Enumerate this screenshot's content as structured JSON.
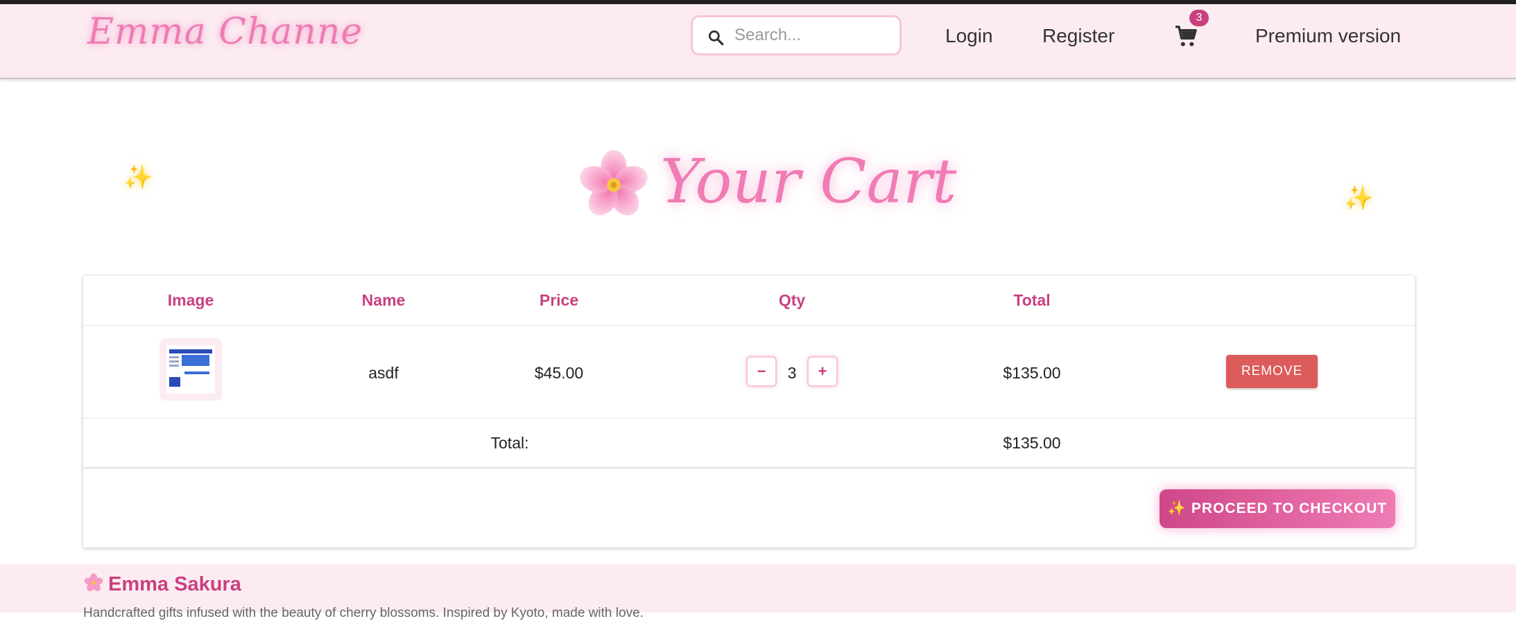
{
  "header": {
    "logo": "Emma Channe",
    "search": {
      "placeholder": "Search...",
      "value": ""
    },
    "nav": {
      "login": "Login",
      "register": "Register",
      "premium": "Premium version"
    },
    "cart_count": "3"
  },
  "main": {
    "title": "Your Cart",
    "sparkle": "✨",
    "table": {
      "headers": [
        "Image",
        "Name",
        "Price",
        "Qty",
        "Total"
      ],
      "items": [
        {
          "name": "asdf",
          "price": "$45.00",
          "qty": "3",
          "total": "$135.00",
          "decrement": "−",
          "increment": "+",
          "remove": "REMOVE"
        }
      ],
      "total_label": "Total:",
      "total_value": "$135.00"
    },
    "checkout": "✨ PROCEED TO CHECKOUT"
  },
  "footer": {
    "brand": "Emma Sakura",
    "description": "Handcrafted gifts infused with the beauty of cherry blossoms. Inspired by Kyoto, made with love."
  },
  "colors": {
    "accent": "#c8407f",
    "pink": "#ef7cb4",
    "header_bg": "#fcecf2",
    "remove": "#dc5b5b"
  },
  "icons": [
    "search-icon",
    "cart-icon",
    "sparkle-icon",
    "cherry-blossom-icon"
  ]
}
